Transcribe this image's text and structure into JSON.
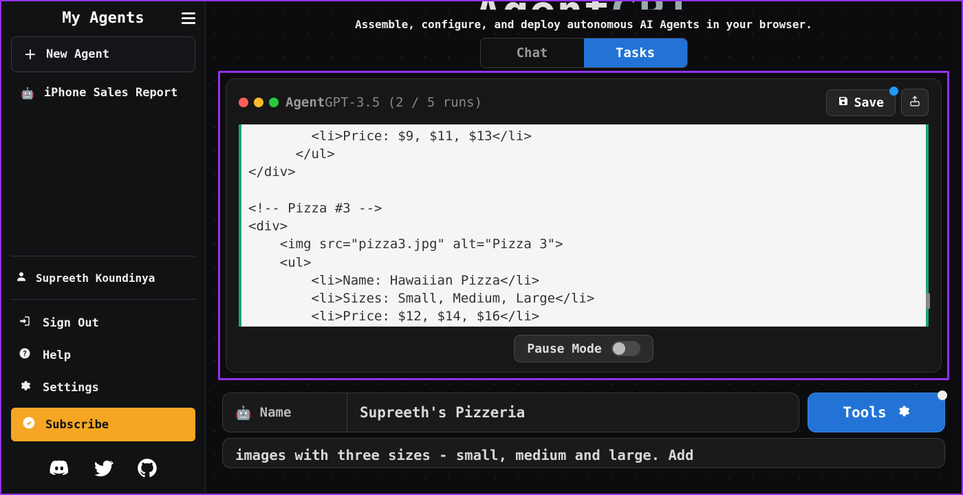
{
  "sidebar": {
    "title": "My Agents",
    "new_agent": "New Agent",
    "agents": [
      {
        "label": "iPhone Sales Report"
      }
    ],
    "user": "Supreeth Koundinya",
    "nav": {
      "sign_out": "Sign Out",
      "help": "Help",
      "settings": "Settings",
      "subscribe": "Subscribe"
    }
  },
  "hero": {
    "title_prefix": "Agent",
    "title_suffix": "GPT",
    "subtitle": "Assemble, configure, and deploy autonomous AI Agents in your browser."
  },
  "tabs": {
    "chat": "Chat",
    "tasks": "Tasks"
  },
  "terminal": {
    "title_prefix": "Agent",
    "title_model": "GPT-3.5",
    "runs": "(2 / 5 runs)",
    "save": "Save",
    "code": "        <li>Price: $9, $11, $13</li>\n      </ul>\n</div>\n\n<!-- Pizza #3 -->\n<div>\n    <img src=\"pizza3.jpg\" alt=\"Pizza 3\">\n    <ul>\n        <li>Name: Hawaiian Pizza</li>\n        <li>Sizes: Small, Medium, Large</li>\n        <li>Price: $12, $14, $16</li>",
    "pause": "Pause Mode"
  },
  "form": {
    "name_label": "Name",
    "name_value": "Supreeth's Pizzeria",
    "tools": "Tools",
    "goal_value": "images with three sizes - small, medium and large. Add"
  }
}
